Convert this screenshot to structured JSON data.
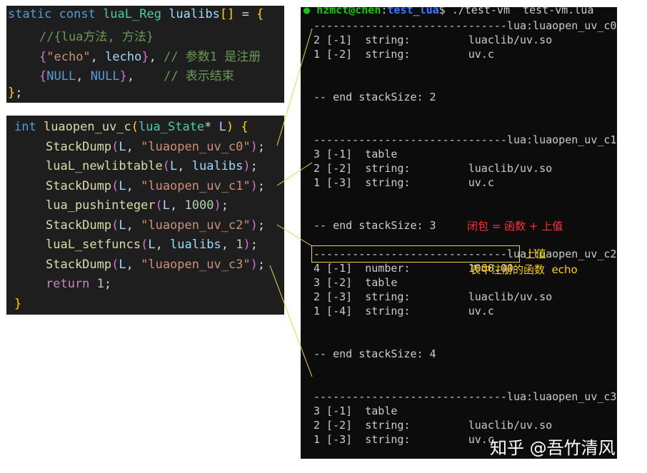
{
  "code_top": {
    "lines": [
      {
        "kw": "static const ",
        "ty": "luaL_Reg",
        "name": " lualibs",
        "br": "[]",
        "eq": " = ",
        "open": "{"
      },
      {
        "comment": "//{lua方法, 方法}"
      },
      {
        "open": "{",
        "str": "\"echo\"",
        "sep": ", ",
        "var": "lecho",
        "close": "}",
        "comma": ",",
        "comment": " // 参数1 是注册"
      },
      {
        "open": "{",
        "var1": "NULL",
        "sep": ", ",
        "var2": "NULL",
        "close": "}",
        "comma": ",",
        "comment": "    // 表示结束"
      },
      {
        "close": "}",
        "semi": ";"
      }
    ]
  },
  "code_bottom": {
    "lines": [
      {
        "ty": "int",
        "fn": " luaopen_uv_c",
        "open": "(",
        "ty2": "lua_State",
        "star": "* ",
        "var": "L",
        "close": ")",
        "brace": " {"
      },
      {
        "fn": "StackDump",
        "open": "(",
        "var": "L",
        "sep": ", ",
        "str": "\"luaopen_uv_c0\"",
        "close": ")",
        "semi": ";"
      },
      {
        "fn": "luaL_newlibtable",
        "open": "(",
        "var": "L",
        "sep": ", ",
        "var2": "lualibs",
        "close": ")",
        "semi": ";"
      },
      {
        "fn": "StackDump",
        "open": "(",
        "var": "L",
        "sep": ", ",
        "str": "\"luaopen_uv_c1\"",
        "close": ")",
        "semi": ";"
      },
      {
        "fn": "lua_pushinteger",
        "open": "(",
        "var": "L",
        "sep": ", ",
        "num": "1000",
        "close": ")",
        "semi": ";"
      },
      {
        "fn": "StackDump",
        "open": "(",
        "var": "L",
        "sep": ", ",
        "str": "\"luaopen_uv_c2\"",
        "close": ")",
        "semi": ";"
      },
      {
        "fn": "luaL_setfuncs",
        "open": "(",
        "var": "L",
        "sep": ", ",
        "var2": "lualibs",
        "sep2": ", ",
        "num": "1",
        "close": ")",
        "semi": ";"
      },
      {
        "fn": "StackDump",
        "open": "(",
        "var": "L",
        "sep": ", ",
        "str": "\"luaopen_uv_c3\"",
        "close": ")",
        "semi": ";"
      },
      {
        "ret": "return",
        "num": " 1",
        "semi": ";"
      },
      {
        "close": "}"
      }
    ]
  },
  "terminal": {
    "prompt_user": "hzmct@chen",
    "prompt_colon": ":",
    "prompt_path": "test_lua",
    "prompt_cmd": "$ ./test-vm  test-vm.lua",
    "lines": [
      "------------------------------lua:luaopen_uv_c0",
      "2 [-1]  string:         luaclib/uv.so",
      "1 [-2]  string:         uv.c",
      "",
      "",
      "-- end stackSize: 2",
      "",
      "",
      "------------------------------lua:luaopen_uv_c1",
      "3 [-1]  table",
      "2 [-2]  string:         luaclib/uv.so",
      "1 [-3]  string:         uv.c",
      "",
      "",
      "-- end stackSize: 3",
      "",
      "------------------------------lua:luaopen_uv_c2",
      "4 [-1]  number:         1000.00",
      "3 [-2]  table",
      "2 [-3]  string:         luaclib/uv.so",
      "1 [-4]  string:         uv.c",
      "",
      "",
      "-- end stackSize: 4",
      "",
      "",
      "------------------------------lua:luaopen_uv_c3",
      "3 [-1]  table",
      "2 [-2]  string:         luaclib/uv.so",
      "1 [-3]  string:         uv.c",
      "",
      "",
      "-- end stackSize: 3"
    ]
  },
  "annotations": {
    "closure": "闭包 = 函数 + 上值",
    "upvalue": "上值",
    "table_func": "表中注册的函数  echo"
  },
  "watermark": "知乎 @吾竹清风",
  "colors": {
    "connector": "#e8d44d",
    "closure_text": "#ff3030",
    "note_text": "#ffd000"
  }
}
